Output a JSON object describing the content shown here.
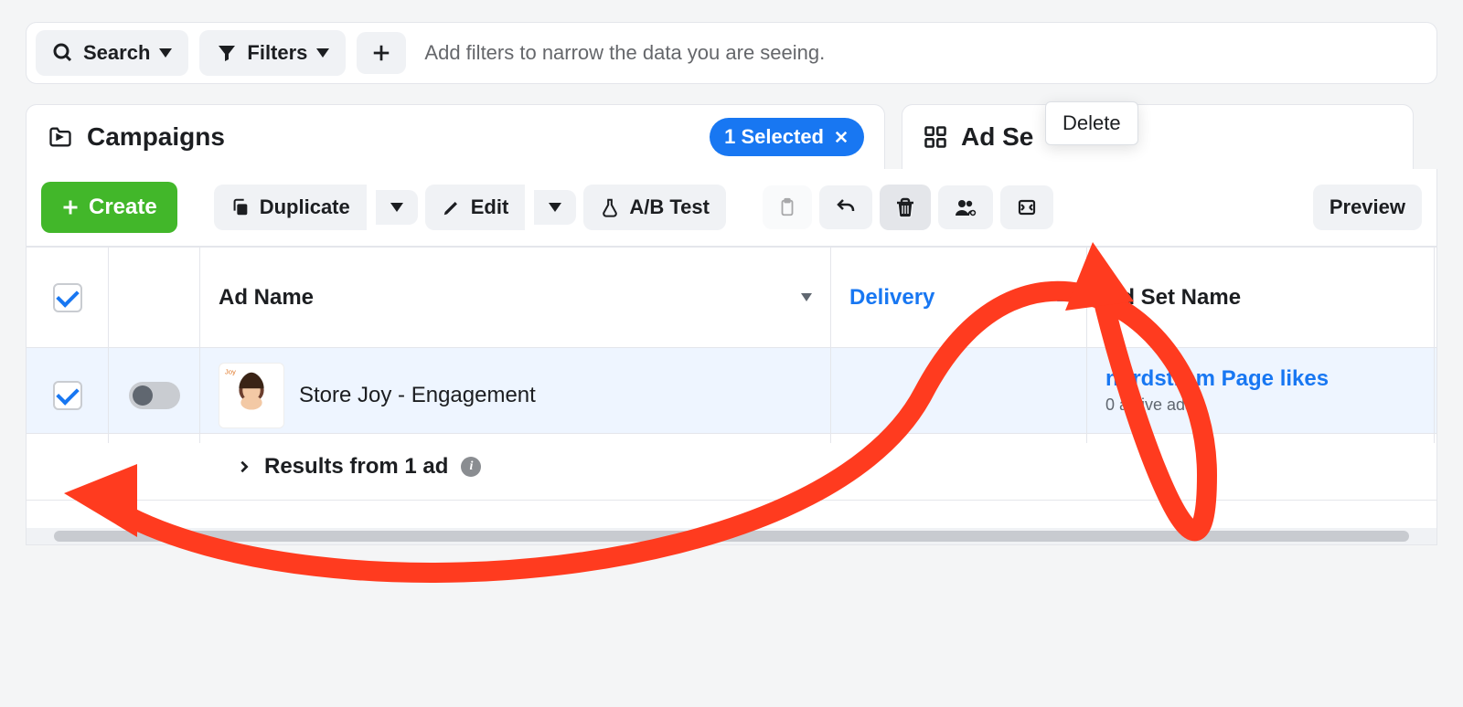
{
  "topbar": {
    "search_label": "Search",
    "filters_label": "Filters",
    "placeholder": "Add filters to narrow the data you are seeing."
  },
  "tabs": {
    "campaigns_label": "Campaigns",
    "selected_chip": "1 Selected",
    "adsets_label": "Ad Se"
  },
  "tooltip": {
    "delete_label": "Delete"
  },
  "toolbar": {
    "create_label": "Create",
    "duplicate_label": "Duplicate",
    "edit_label": "Edit",
    "abtest_label": "A/B Test",
    "preview_label": "Preview"
  },
  "columns": {
    "ad_name": "Ad Name",
    "delivery": "Delivery",
    "ad_set_name": "Ad Set Name"
  },
  "rows": [
    {
      "name": "Store Joy - Engagement",
      "delivery": "",
      "ad_set_name": "nordstrom Page likes",
      "ad_set_sub": "0 active ads",
      "checked": true,
      "toggle_on": false
    }
  ],
  "results": {
    "label": "Results from 1 ad"
  }
}
